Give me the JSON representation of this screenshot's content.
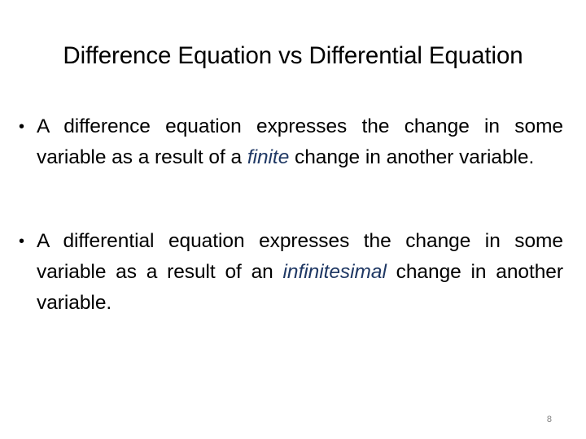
{
  "slide": {
    "title": "Difference Equation vs Differential Equation",
    "page_number": "8",
    "background_color": "#FFFFFF",
    "title_color": "#000000",
    "body_color": "#000000",
    "emphasis_color": "#1F3864",
    "page_number_color": "#808080",
    "bullet_marker": "•"
  },
  "bullets": [
    {
      "marker": "•",
      "text_before_emphasis": "A difference equation expresses the change in some variable as a result of a ",
      "emphasis": "finite",
      "text_after_emphasis": " change in another variable.",
      "full_text": "A difference equation expresses the change in some variable as a result of a finite change in another variable."
    },
    {
      "marker": "•",
      "text_before_emphasis": "A differential equation expresses the change in some variable as a result of an ",
      "emphasis": "infinitesimal",
      "text_after_emphasis": " change in another variable.",
      "full_text": "A differential equation expresses the change in some variable as a result of an infinitesimal change in another variable."
    }
  ]
}
